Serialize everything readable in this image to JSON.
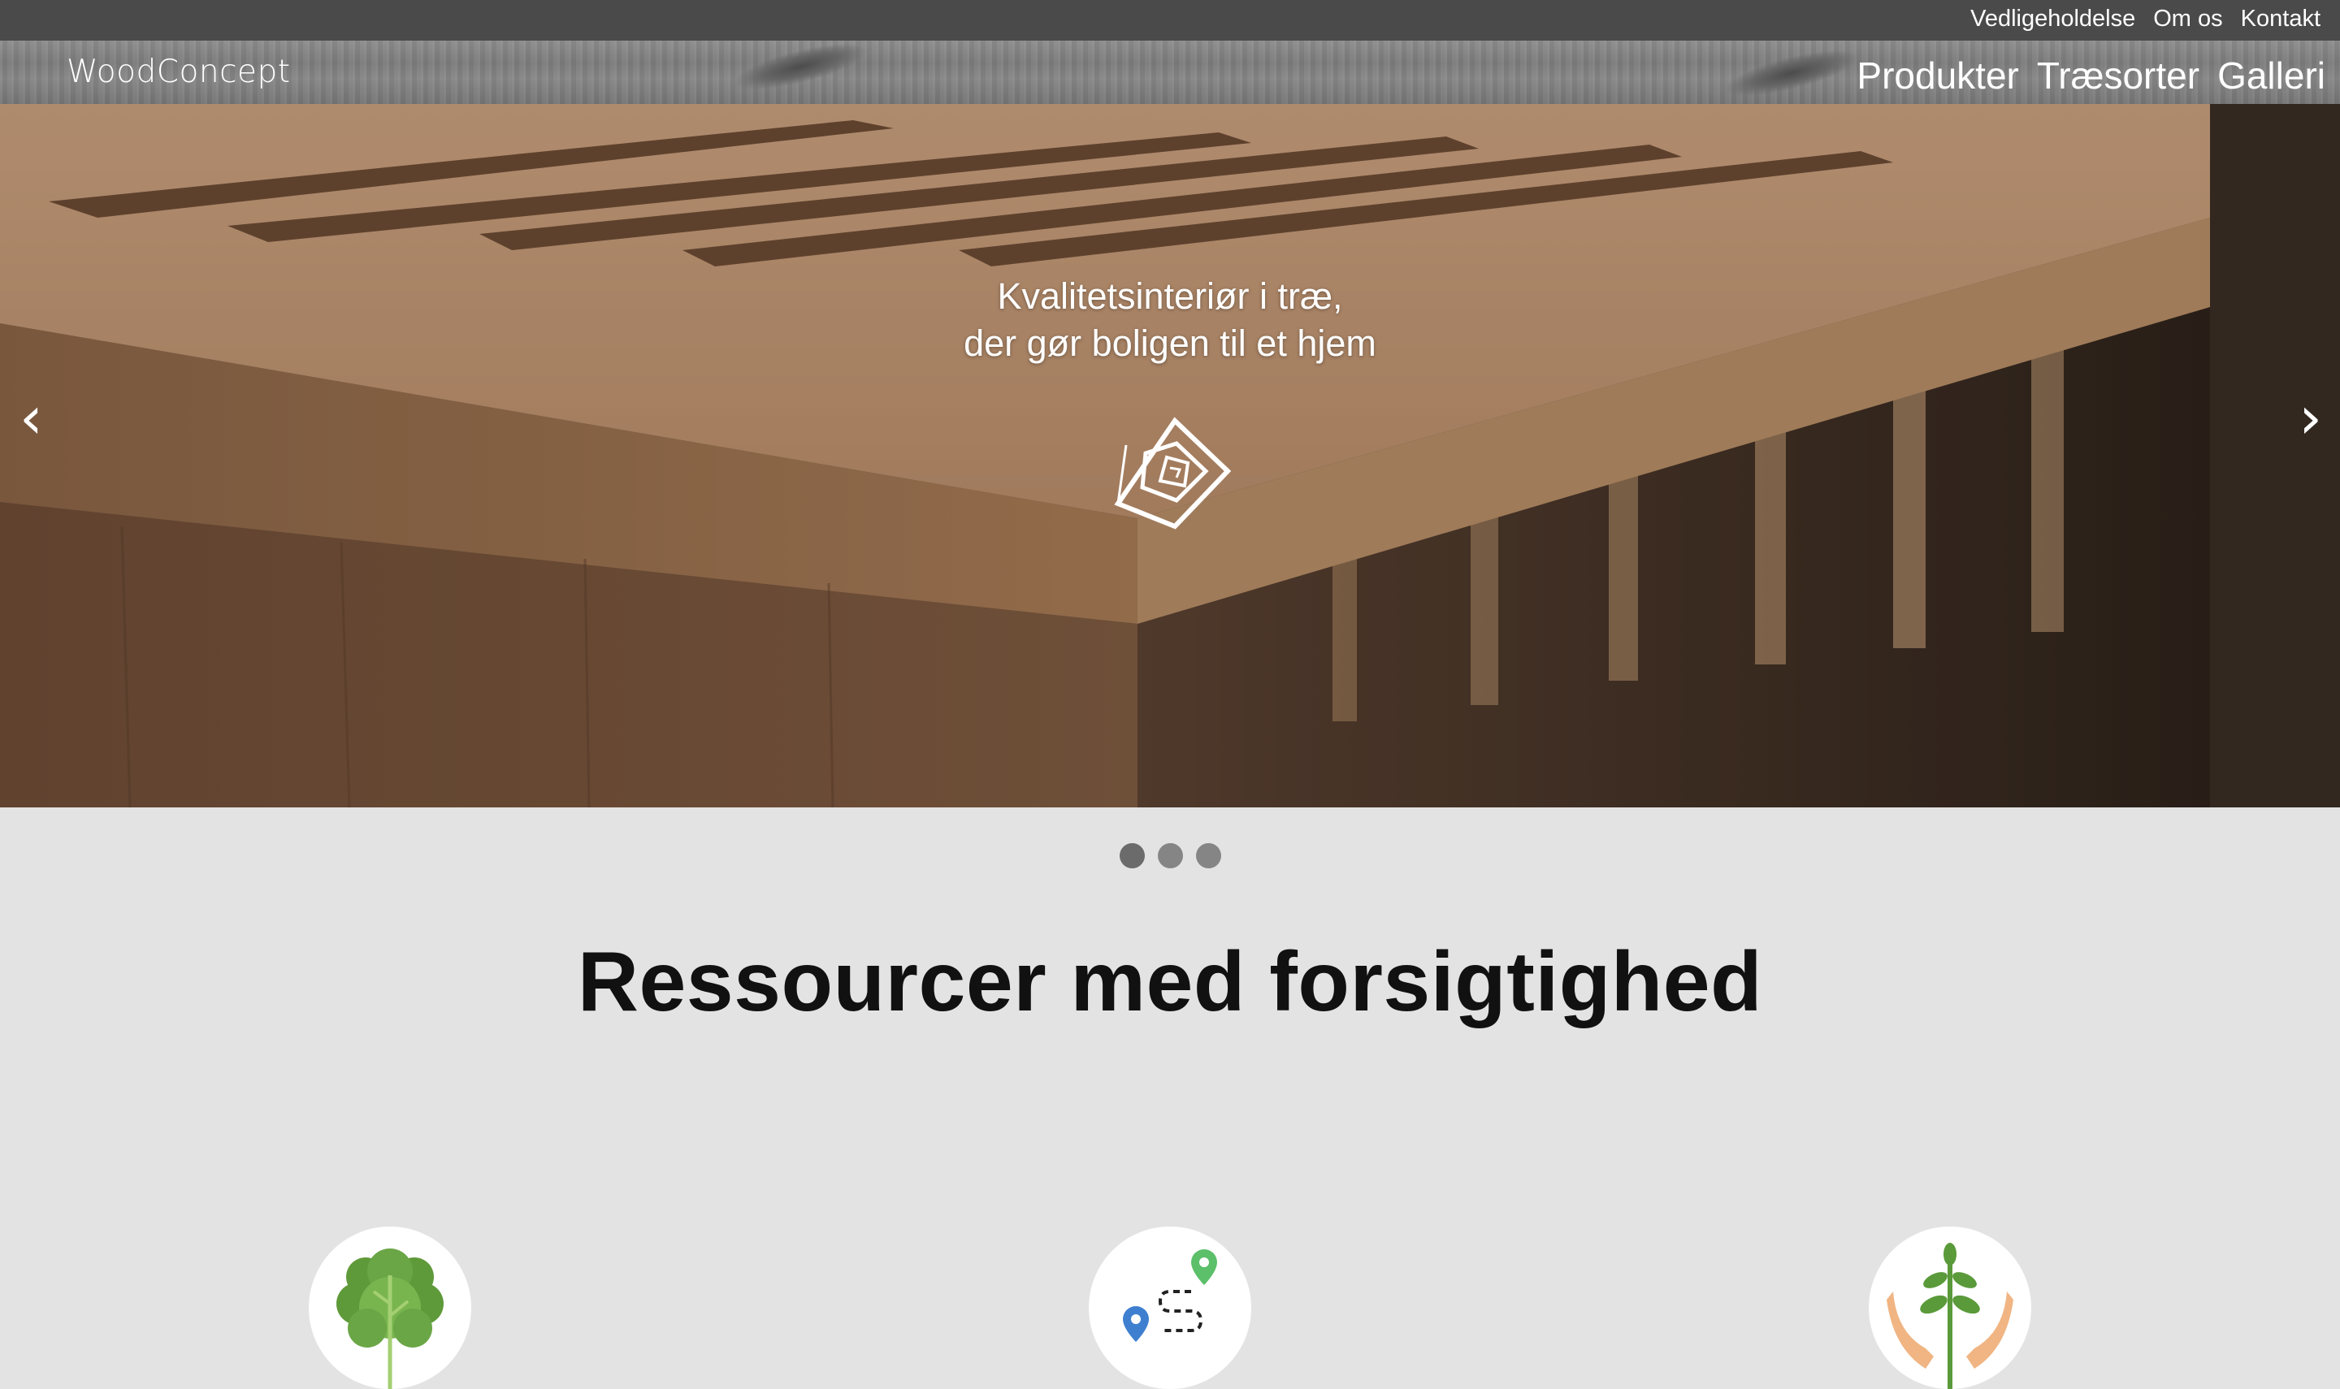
{
  "header": {
    "utility_links": [
      "Vedligeholdelse",
      "Om os",
      "Kontakt"
    ],
    "brand": "WoodConcept",
    "nav": [
      "Produkter",
      "Træsorter",
      "Galleri"
    ]
  },
  "hero": {
    "tagline_line1": "Kvalitetsinteriør i træ,",
    "tagline_line2": "der gør boligen til et hjem",
    "prev_arrow": "‹",
    "next_arrow": "›",
    "slide_count": 3,
    "active_slide": 1
  },
  "section": {
    "title": "Ressourcer med forsigtighed"
  },
  "features": [
    {
      "icon": "tree-icon"
    },
    {
      "icon": "route-map-icon"
    },
    {
      "icon": "hands-plant-icon"
    }
  ],
  "colors": {
    "topbar": "#4a4a4a",
    "page_background": "#e3e3e3",
    "dot": "#858585",
    "heading": "#111111"
  }
}
